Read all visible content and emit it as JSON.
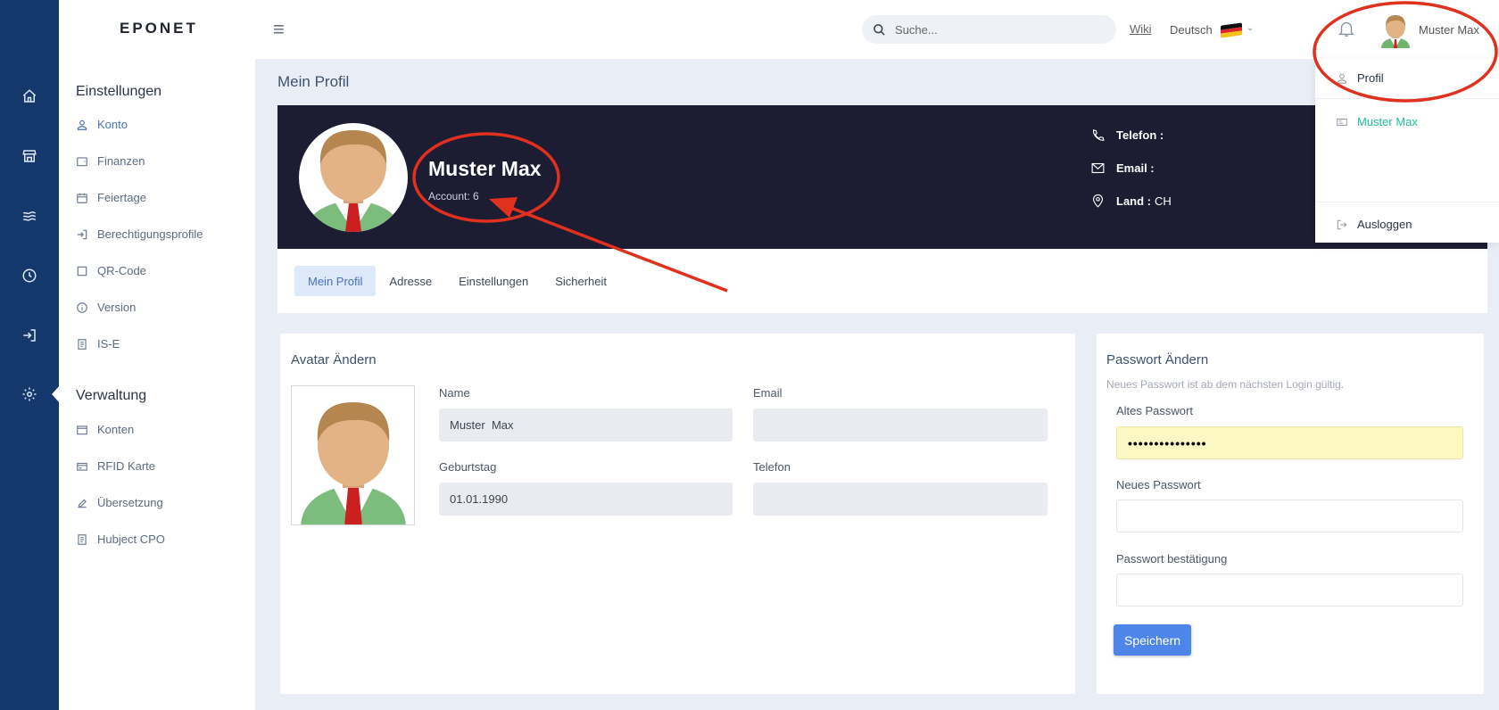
{
  "app": {
    "logo": "EPONET"
  },
  "header": {
    "search_placeholder": "Suche...",
    "wiki_label": "Wiki",
    "language_label": "Deutsch",
    "user_name": "Muster Max"
  },
  "sidebar": {
    "section_settings": "Einstellungen",
    "settings_items": [
      {
        "label": "Konto",
        "icon": "user-icon"
      },
      {
        "label": "Finanzen",
        "icon": "wallet-icon"
      },
      {
        "label": "Feiertage",
        "icon": "calendar-icon"
      },
      {
        "label": "Berechtigungsprofile",
        "icon": "sign-in-icon"
      },
      {
        "label": "QR-Code",
        "icon": "square-icon"
      },
      {
        "label": "Version",
        "icon": "info-icon"
      },
      {
        "label": "IS-E",
        "icon": "document-icon"
      }
    ],
    "section_admin": "Verwaltung",
    "admin_items": [
      {
        "label": "Konten",
        "icon": "window-icon"
      },
      {
        "label": "RFID Karte",
        "icon": "card-icon"
      },
      {
        "label": "Übersetzung",
        "icon": "edit-icon"
      },
      {
        "label": "Hubject CPO",
        "icon": "document-icon"
      }
    ]
  },
  "page": {
    "title": "Mein Profil"
  },
  "profile": {
    "name": "Muster Max",
    "account": "Account: 6",
    "phone_label": "Telefon :",
    "phone_value": "",
    "email_label": "Email :",
    "email_value": "",
    "country_label": "Land :",
    "country_value": "CH"
  },
  "tabs": [
    "Mein Profil",
    "Adresse",
    "Einstellungen",
    "Sicherheit"
  ],
  "active_tab": "Mein Profil",
  "avatar_panel": {
    "title": "Avatar Ändern",
    "name_label": "Name",
    "name_value": "Muster  Max",
    "email_label": "Email",
    "email_value": "",
    "birthday_label": "Geburtstag",
    "birthday_value": "01.01.1990",
    "phone_label": "Telefon",
    "phone_value": ""
  },
  "password_panel": {
    "title": "Passwort Ändern",
    "hint": "Neues Passwort ist ab dem nächsten Login gültig.",
    "old_label": "Altes Passwort",
    "old_value": "•••••••••••••••",
    "new_label": "Neues Passwort",
    "confirm_label": "Passwort bestätigung",
    "save_label": "Speichern"
  },
  "user_menu": {
    "profile_label": "Profil",
    "account_label": "Muster Max",
    "logout_label": "Ausloggen"
  },
  "colors": {
    "rail": "#14386b",
    "banner": "#1c1c32",
    "accent": "#4d86e8",
    "link_green": "#1fbf9a",
    "annotation_red": "#e0301e"
  }
}
